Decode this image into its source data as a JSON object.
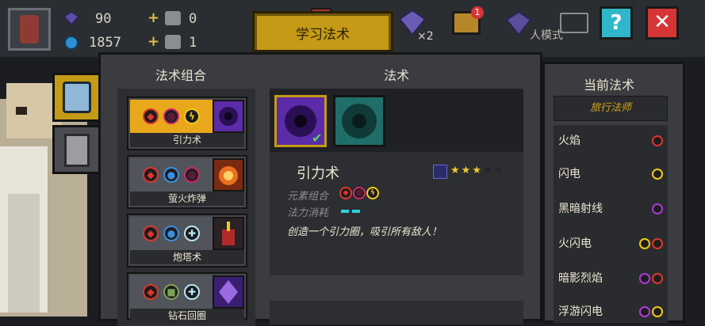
{
  "hud": {
    "gems": "90",
    "energy": "1857",
    "slot1": "0",
    "slot2": "1",
    "mode_label": "人模式",
    "gem_multiplier": "×2",
    "chest_badge": "1"
  },
  "title": "学习法术",
  "help_label": "?",
  "close_label": "✕",
  "combo_panel": {
    "heading": "法术组合",
    "spells": [
      {
        "name": "引力术",
        "elements": [
          "fire",
          "dark",
          "light"
        ],
        "selected": true
      },
      {
        "name": "萤火炸弹",
        "elements": [
          "fire",
          "water",
          "dark"
        ],
        "selected": false
      },
      {
        "name": "炮塔术",
        "elements": [
          "fire",
          "water",
          "ice"
        ],
        "selected": false
      },
      {
        "name": "钻石回圈",
        "elements": [
          "fire",
          "earth",
          "ice"
        ],
        "selected": false
      }
    ]
  },
  "detail_panel": {
    "heading": "法术",
    "name": "引力术",
    "stars_filled": 3,
    "stars_total": 5,
    "combo_label": "元素组合",
    "cost_label": "法力消耗",
    "description": "创造一个引力圈，吸引所有敌人！"
  },
  "current_panel": {
    "heading": "当前法术",
    "class_name": "旅行法师",
    "spells": [
      {
        "name": "火焰",
        "elements": [
          "fire"
        ]
      },
      {
        "name": "闪电",
        "elements": [
          "light"
        ]
      },
      {
        "name": "黑暗射线",
        "elements": [
          "dark"
        ]
      },
      {
        "name": "火闪电",
        "elements": [
          "light",
          "fire"
        ]
      },
      {
        "name": "暗影烈焰",
        "elements": [
          "dark",
          "fire"
        ]
      },
      {
        "name": "浮游闪电",
        "elements": [
          "dark",
          "light"
        ]
      }
    ]
  },
  "colors": {
    "accent_gold": "#c49a16",
    "fire": "#e0352c",
    "dark": "#d0266a",
    "light": "#f0c81c",
    "water": "#3a8de0",
    "ice": "#b6e6f7",
    "earth": "#7fa25a"
  }
}
